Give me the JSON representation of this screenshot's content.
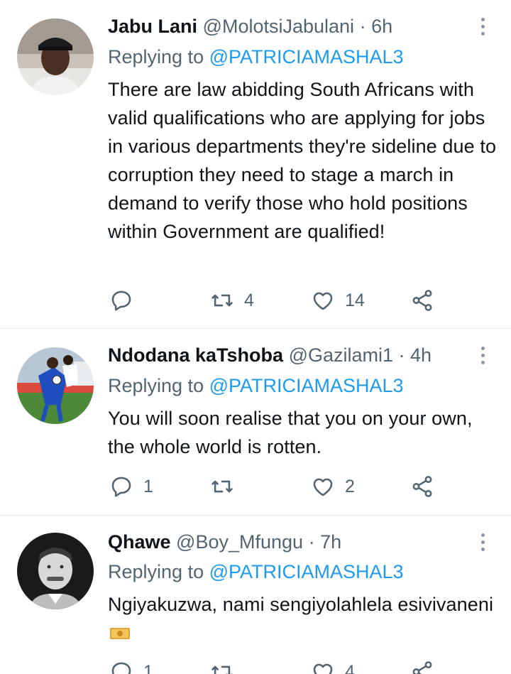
{
  "tweets": [
    {
      "name": "Jabu Lani",
      "handle": "@MolotsiJabulani",
      "time": "6h",
      "replying_label": "Replying to",
      "replying_handle": "@PATRICIAMASHAL3",
      "text": "There are law abidding South Africans with valid qualifications who are applying for jobs in various departments they're sideline due to corruption they need to stage a march in demand to verify those who hold positions within Government are qualified!",
      "replies": "",
      "retweets": "4",
      "likes": "14"
    },
    {
      "name": "Ndodana kaTshoba",
      "handle": "@Gazilami1",
      "time": "4h",
      "replying_label": "Replying to",
      "replying_handle": "@PATRICIAMASHAL3",
      "text": "You will soon realise that you on your own, the whole world is rotten.",
      "replies": "1",
      "retweets": "",
      "likes": "2"
    },
    {
      "name": "Qhawe",
      "handle": "@Boy_Mfungu",
      "time": "7h",
      "replying_label": "Replying to",
      "replying_handle": "@PATRICIAMASHAL3",
      "text": "Ngiyakuzwa, nami sengiyolahlela esivivaneni",
      "replies": "1",
      "retweets": "",
      "likes": "4"
    }
  ],
  "sep": " · ",
  "icons": {
    "reply": "reply-icon",
    "retweet": "retweet-icon",
    "like": "like-icon",
    "share": "share-icon",
    "more": "more-vertical-icon",
    "emoji": "money-emoji-icon"
  },
  "colors": {
    "link": "#1d9bf0",
    "muted": "#536471",
    "text": "#0f1419",
    "divider": "#e6ecf0"
  }
}
